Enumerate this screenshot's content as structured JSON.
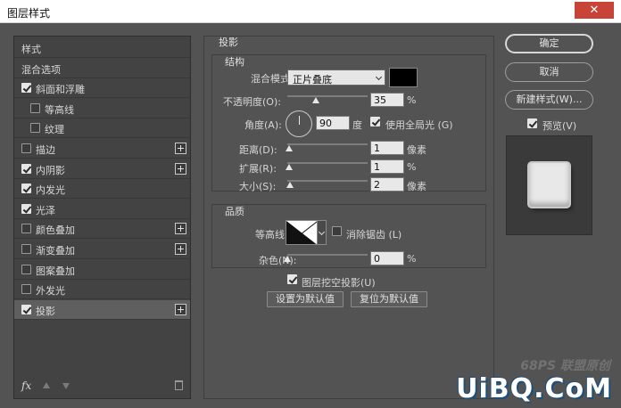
{
  "window": {
    "title": "图层样式",
    "close_glyph": "✕"
  },
  "left_panel": {
    "items": [
      {
        "label": "样式",
        "checkbox": false,
        "checked": false,
        "plus": false,
        "indent": 0,
        "active": false
      },
      {
        "label": "混合选项",
        "checkbox": false,
        "checked": false,
        "plus": false,
        "indent": 0,
        "active": false
      },
      {
        "label": "斜面和浮雕",
        "checkbox": true,
        "checked": true,
        "plus": false,
        "indent": 0,
        "active": false
      },
      {
        "label": "等高线",
        "checkbox": true,
        "checked": false,
        "plus": false,
        "indent": 1,
        "active": false
      },
      {
        "label": "纹理",
        "checkbox": true,
        "checked": false,
        "plus": false,
        "indent": 1,
        "active": false
      },
      {
        "label": "描边",
        "checkbox": true,
        "checked": false,
        "plus": true,
        "indent": 0,
        "active": false
      },
      {
        "label": "内阴影",
        "checkbox": true,
        "checked": true,
        "plus": true,
        "indent": 0,
        "active": false
      },
      {
        "label": "内发光",
        "checkbox": true,
        "checked": true,
        "plus": false,
        "indent": 0,
        "active": false
      },
      {
        "label": "光泽",
        "checkbox": true,
        "checked": true,
        "plus": false,
        "indent": 0,
        "active": false
      },
      {
        "label": "颜色叠加",
        "checkbox": true,
        "checked": false,
        "plus": true,
        "indent": 0,
        "active": false
      },
      {
        "label": "渐变叠加",
        "checkbox": true,
        "checked": false,
        "plus": true,
        "indent": 0,
        "active": false
      },
      {
        "label": "图案叠加",
        "checkbox": true,
        "checked": false,
        "plus": false,
        "indent": 0,
        "active": false
      },
      {
        "label": "外发光",
        "checkbox": true,
        "checked": false,
        "plus": false,
        "indent": 0,
        "active": false
      },
      {
        "label": "投影",
        "checkbox": true,
        "checked": true,
        "plus": true,
        "indent": 0,
        "active": true
      }
    ],
    "footer": {
      "fx_label": "fx"
    }
  },
  "drop_shadow": {
    "section_title": "投影",
    "structure": {
      "title": "结构",
      "blend_mode_label": "混合模式:",
      "blend_mode_value": "正片叠底",
      "color": "#000000",
      "opacity_label": "不透明度(O):",
      "opacity_value": "35",
      "opacity_unit": "%",
      "opacity_fraction": 0.35,
      "angle_label": "角度(A):",
      "angle_value": "90",
      "angle_unit": "度",
      "global_light_label": "使用全局光 (G)",
      "global_light_checked": true,
      "distance_label": "距离(D):",
      "distance_value": "1",
      "distance_unit": "像素",
      "spread_label": "扩展(R):",
      "spread_value": "1",
      "spread_unit": "%",
      "size_label": "大小(S):",
      "size_value": "2",
      "size_unit": "像素"
    },
    "quality": {
      "title": "品质",
      "contour_label": "等高线:",
      "antialias_label": "消除锯齿 (L)",
      "antialias_checked": false,
      "noise_label": "杂色(N):",
      "noise_value": "0",
      "noise_unit": "%"
    },
    "knockout_label": "图层挖空投影(U)",
    "knockout_checked": true,
    "make_default_label": "设置为默认值",
    "reset_default_label": "复位为默认值"
  },
  "right_panel": {
    "ok_label": "确定",
    "cancel_label": "取消",
    "new_style_label": "新建样式(W)...",
    "preview_label": "预览(V)",
    "preview_checked": true
  },
  "watermark": {
    "line1": "68PS 联盟原创",
    "line2": "UiBQ.CoM"
  }
}
